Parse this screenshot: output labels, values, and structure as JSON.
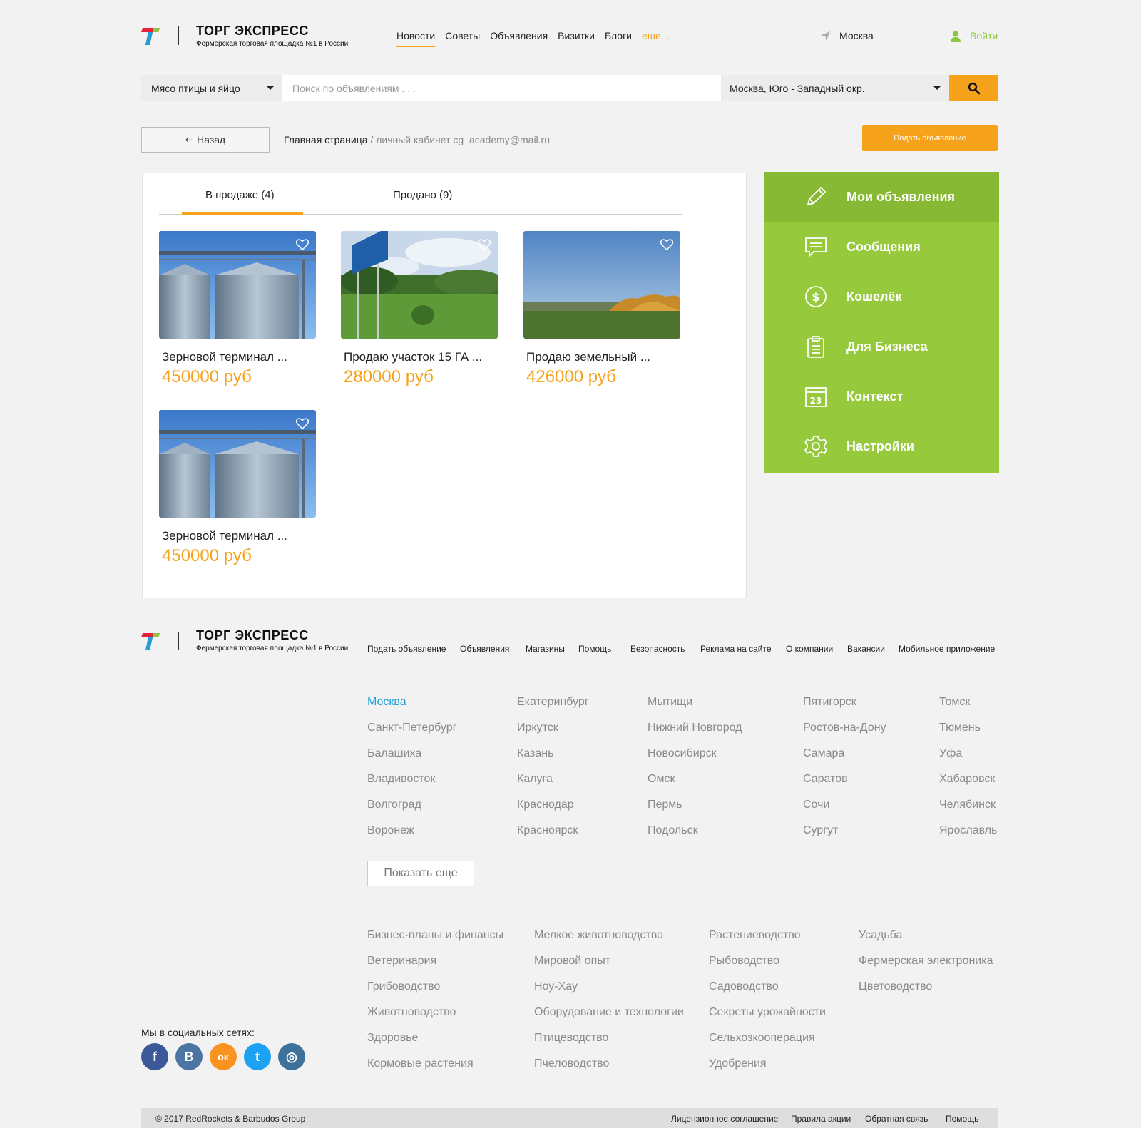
{
  "header": {
    "brand": "ТОРГ ЭКСПРЕСС",
    "tagline": "Фермерская торговая площадка №1 в России",
    "nav": [
      "Новости",
      "Советы",
      "Объявления",
      "Визитки",
      "Блоги",
      "еще..."
    ],
    "city": "Москва",
    "login": "Войти"
  },
  "search": {
    "category": "Мясо птицы и яйцо",
    "placeholder": "Поиск по объявлениям . . .",
    "region": "Москва, Юго - Западный окр."
  },
  "breadcrumb": {
    "back": "Назад",
    "home": "Главная страница",
    "separator": " / ",
    "current": "личный кабинет cg_academy@mail.ru"
  },
  "post_button": "Подать объявление",
  "tabs": [
    "В продаже (4)",
    "Продано (9)"
  ],
  "listings": [
    {
      "title": "Зерновой терминал ...",
      "price": "450000 руб",
      "image": "silos"
    },
    {
      "title": "Продаю участок 15 ГА ...",
      "price": "280000 руб",
      "image": "field-sign"
    },
    {
      "title": "Продаю земельный ...",
      "price": "426000 руб",
      "image": "autumn-field"
    },
    {
      "title": "Зерновой терминал ...",
      "price": "450000 руб",
      "image": "silos"
    }
  ],
  "sidebar": [
    {
      "label": "Мои объявления",
      "icon": "pencil-icon"
    },
    {
      "label": "Сообщения",
      "icon": "message-icon"
    },
    {
      "label": "Кошелёк",
      "icon": "dollar-icon"
    },
    {
      "label": "Для Бизнеса",
      "icon": "clipboard-icon"
    },
    {
      "label": "Контекст",
      "icon": "calendar-icon"
    },
    {
      "label": "Настройки",
      "icon": "gear-icon"
    }
  ],
  "calendar_day": "23",
  "footer": {
    "brand": "ТОРГ ЭКСПРЕСС",
    "tagline": "Фермерская торговая площадка №1 в России",
    "nav": [
      "Подать объявление",
      "Объявления",
      "Магазины",
      "Помощь",
      "Безопасность",
      "Реклама на сайте",
      "О компании",
      "Вакансии",
      "Мобильное приложение"
    ],
    "cities": [
      [
        "Москва",
        "Санкт-Петербург",
        "Балашиха",
        "Владивосток",
        "Волгоград",
        "Воронеж"
      ],
      [
        "Екатеринбург",
        "Иркутск",
        "Казань",
        "Калуга",
        "Краснодар",
        "Красноярск"
      ],
      [
        "Мытищи",
        "Нижний Новгород",
        "Новосибирск",
        "Омск",
        "Пермь",
        "Подольск"
      ],
      [
        "Пятигорск",
        "Ростов-на-Дону",
        "Самара",
        "Саратов",
        "Сочи",
        "Сургут"
      ],
      [
        "Томск",
        "Тюмень",
        "Уфа",
        "Хабаровск",
        "Челябинск",
        "Ярославль"
      ]
    ],
    "show_more": "Показать еще",
    "categories": [
      [
        "Бизнес-планы и финансы",
        "Ветеринария",
        "Грибоводство",
        "Животноводство",
        "Здоровье",
        "Кормовые растения"
      ],
      [
        "Мелкое животноводство",
        "Мировой опыт",
        "Ноу-Хау",
        "Оборудование и технологии",
        "Птицеводство",
        "Пчеловодство"
      ],
      [
        "Растениеводство",
        "Рыбоводство",
        "Садоводство",
        "Секреты урожайности",
        "Сельхозкооперация",
        "Удобрения"
      ],
      [
        "Усадьба",
        "Фермерская электроника",
        "Цветоводство"
      ]
    ],
    "social_label": "Мы в социальных сетях:",
    "social": [
      {
        "name": "facebook",
        "glyph": "f",
        "color": "#3b5998"
      },
      {
        "name": "vk",
        "glyph": "В",
        "color": "#4c75a3"
      },
      {
        "name": "odnoklassniki",
        "glyph": "ок",
        "color": "#f7931e"
      },
      {
        "name": "twitter",
        "glyph": "t",
        "color": "#1da1f2"
      },
      {
        "name": "instagram",
        "glyph": "◎",
        "color": "#3f729b"
      }
    ],
    "copyright": "© 2017 RedRockets & Barbudos Group",
    "bottom_links": [
      "Лицензионное соглашение",
      "Правила акции",
      "Обратная связь",
      "Помощь"
    ]
  },
  "colors": {
    "accent": "#f7a21b",
    "green": "#97c93d",
    "green_active": "#88b935",
    "link_blue": "#1fa0d8"
  }
}
